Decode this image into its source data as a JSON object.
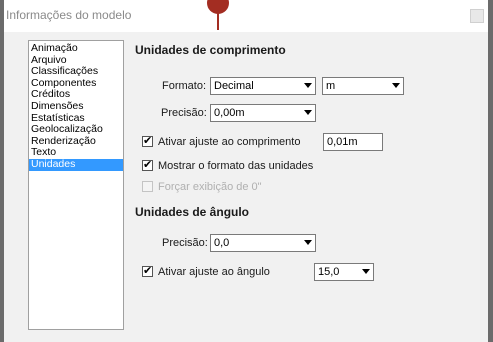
{
  "window": {
    "title": "Informações do modelo"
  },
  "sidebar": {
    "items": [
      {
        "label": "Animação"
      },
      {
        "label": "Arquivo"
      },
      {
        "label": "Classificações"
      },
      {
        "label": "Componentes"
      },
      {
        "label": "Créditos"
      },
      {
        "label": "Dimensões"
      },
      {
        "label": "Estatísticas"
      },
      {
        "label": "Geolocalização"
      },
      {
        "label": "Renderização"
      },
      {
        "label": "Texto"
      },
      {
        "label": "Unidades",
        "selected": true
      }
    ]
  },
  "length_units": {
    "title": "Unidades de comprimento",
    "format_label": "Formato:",
    "format_value": "Decimal",
    "unit_value": "m",
    "precision_label": "Precisão:",
    "precision_value": "0,00m",
    "snap_label": "Ativar ajuste ao comprimento",
    "snap_checked": true,
    "snap_value": "0,01m",
    "show_format_label": "Mostrar o formato das unidades",
    "show_format_checked": true,
    "force_label": "Forçar exibição de 0\"",
    "force_checked": false,
    "force_enabled": false
  },
  "angle_units": {
    "title": "Unidades de ângulo",
    "precision_label": "Precisão:",
    "precision_value": "0,0",
    "snap_label": "Ativar ajuste ao ângulo",
    "snap_checked": true,
    "snap_value": "15,0"
  },
  "colors": {
    "selection": "#3399ff",
    "marker": "#a32d22"
  }
}
